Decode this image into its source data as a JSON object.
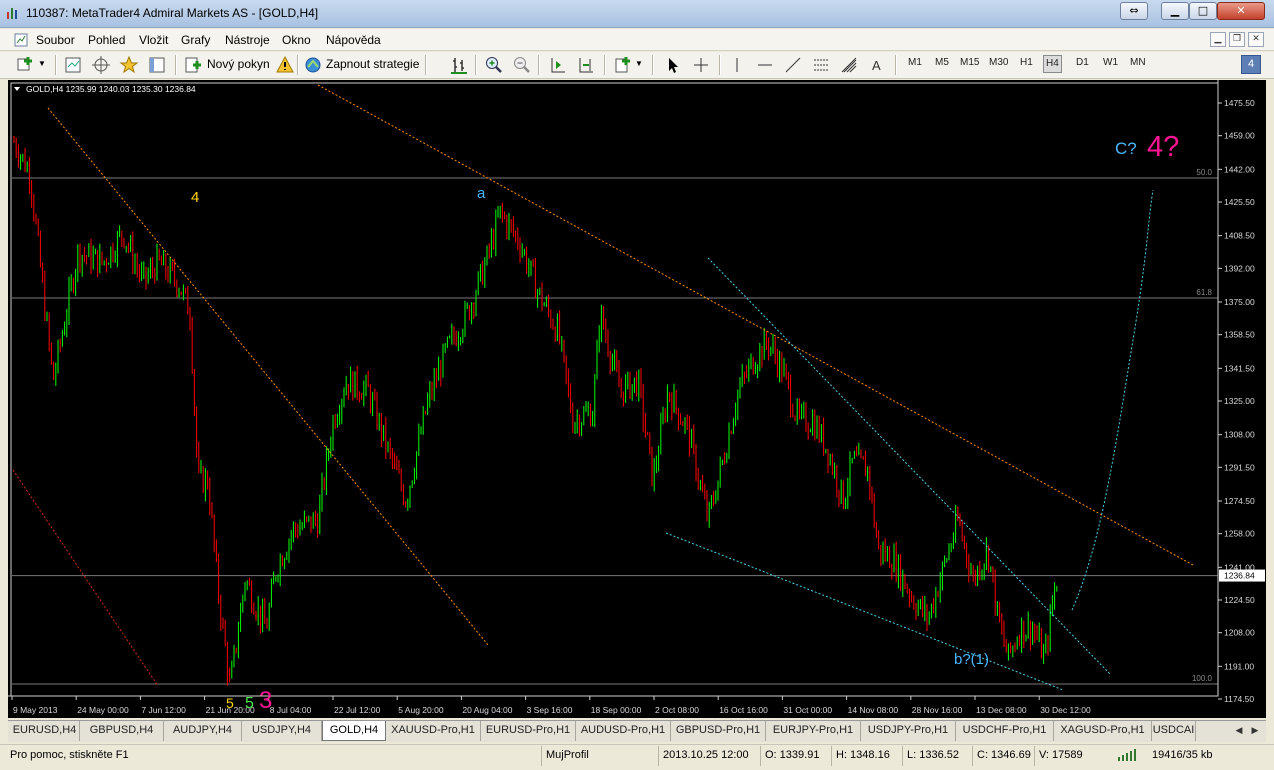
{
  "window": {
    "title": "110387: MetaTrader4 Admiral Markets AS - [GOLD,H4]"
  },
  "menu": [
    "Soubor",
    "Pohled",
    "Vložit",
    "Grafy",
    "Nástroje",
    "Okno",
    "Nápověda"
  ],
  "toolbar": {
    "new_order_label": "Nový pokyn",
    "autotrading_label": "Zapnout strategie",
    "timeframes": [
      "M1",
      "M5",
      "M15",
      "M30",
      "H1",
      "H4",
      "D1",
      "W1",
      "MN"
    ],
    "active_timeframe": "H4",
    "text_tool_label": "A",
    "window_count_badge": "4"
  },
  "chart": {
    "header": "GOLD,H4  1235.99 1240.03 1235.30 1236.84",
    "current_price": "1236.84",
    "price_axis_labels": [
      "1475.50",
      "1459.00",
      "1442.00",
      "1425.50",
      "1408.50",
      "1392.00",
      "1375.00",
      "1358.50",
      "1341.50",
      "1325.00",
      "1308.00",
      "1291.50",
      "1274.50",
      "1258.00",
      "1241.00",
      "1224.50",
      "1208.00",
      "1191.00",
      "1174.50"
    ],
    "time_axis_labels": [
      "9 May 2013",
      "24 May 00:00",
      "7 Jun 12:00",
      "21 Jun 20:00",
      "8 Jul 04:00",
      "22 Jul 12:00",
      "5 Aug 20:00",
      "20 Aug 04:00",
      "3 Sep 16:00",
      "18 Sep 00:00",
      "2 Oct 08:00",
      "16 Oct 16:00",
      "31 Oct 00:00",
      "14 Nov 08:00",
      "28 Nov 16:00",
      "13 Dec 08:00",
      "30 Dec 12:00"
    ],
    "fib_labels": [
      "50.0",
      "61.8",
      "100.0"
    ],
    "annotations": {
      "wave_4_top": "4",
      "wave_a": "a",
      "wave_c": "C?",
      "wave_4_big": "4?",
      "wave_b": "b?(1)",
      "wave_5a": "5",
      "wave_5b": "5",
      "wave_3": "3"
    },
    "colors": {
      "bull": "#00ff00",
      "bear": "#ff0000",
      "orange_line": "#ff8c00",
      "cyan_line": "#48d1e8",
      "yellow_label": "#ffd700",
      "magenta_label": "#ff1493"
    }
  },
  "tabs": [
    "EURUSD,H4",
    "GBPUSD,H4",
    "AUDJPY,H4",
    "USDJPY,H4",
    "GOLD,H4",
    "XAUUSD-Pro,H1",
    "EURUSD-Pro,H1",
    "AUDUSD-Pro,H1",
    "GBPUSD-Pro,H1",
    "EURJPY-Pro,H1",
    "USDJPY-Pro,H1",
    "USDCHF-Pro,H1",
    "XAGUSD-Pro,H1",
    "USDCAI"
  ],
  "active_tab": "GOLD,H4",
  "status": {
    "help": "Pro pomoc, stiskněte F1",
    "profile": "MujProfil",
    "datetime": "2013.10.25 12:00",
    "open": "O: 1339.91",
    "high": "H: 1348.16",
    "low": "L: 1336.52",
    "close": "C: 1346.69",
    "volume": "V: 17589",
    "traffic": "19416/35 kb"
  }
}
